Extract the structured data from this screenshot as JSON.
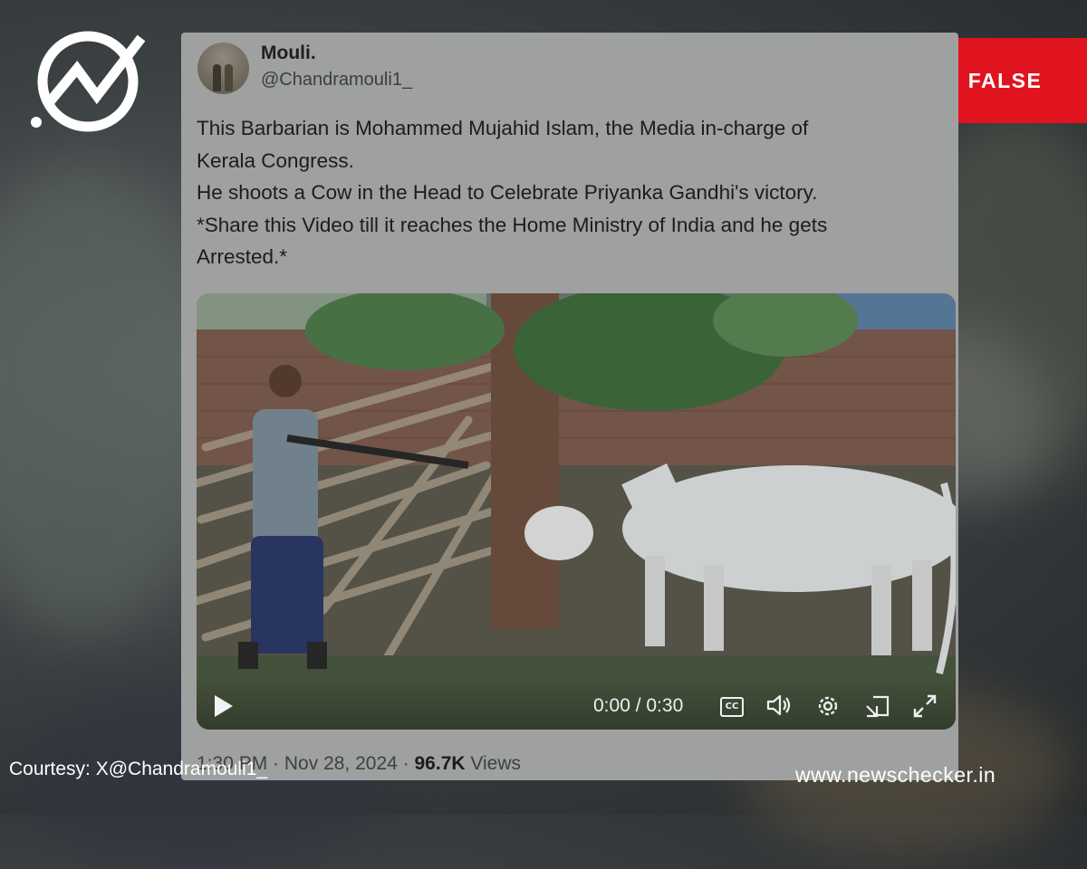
{
  "brand": {
    "logo_icon": "newschecker-check-logo"
  },
  "verdict": {
    "icon": "exclamation-icon",
    "label": "FALSE",
    "color": "#e0141e"
  },
  "tweet": {
    "display_name": "Mouli.",
    "handle": "@Chandramouli1_",
    "text_lines": [
      "This Barbarian is Mohammed Mujahid Islam, the Media in-charge of",
      "Kerala Congress.",
      "He shoots a Cow in the Head to Celebrate Priyanka Gandhi's victory.",
      "*Share this Video till it reaches the Home Ministry of India and he gets",
      "Arrested.*"
    ],
    "video": {
      "time": "0:00 / 0:30",
      "cc_label": "CC",
      "icons": [
        "play-icon",
        "cc-icon",
        "volume-icon",
        "settings-icon",
        "pip-icon",
        "fullscreen-icon"
      ]
    },
    "meta": {
      "time": "1:30 PM",
      "date": "Nov 28, 2024",
      "views_count": "96.7K",
      "views_label": "Views"
    }
  },
  "footer": {
    "courtesy": "Courtesy: X@Chandramouli1_",
    "site": "www.newschecker.in"
  }
}
